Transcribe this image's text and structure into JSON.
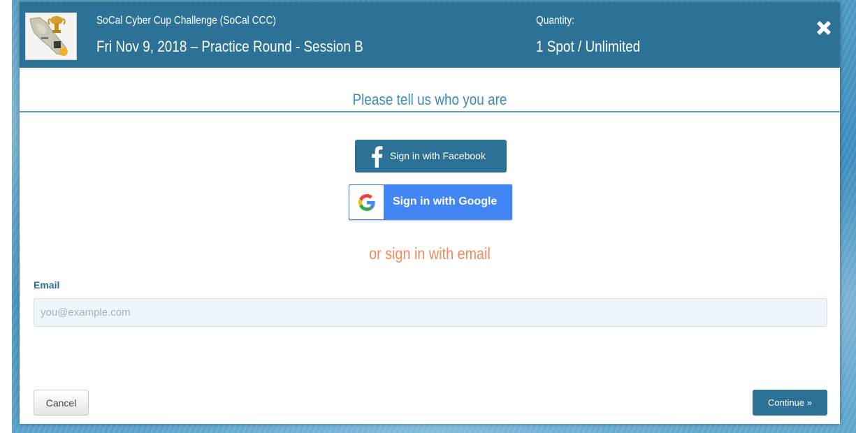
{
  "header": {
    "event_name": "SoCal Cyber Cup Challenge (SoCal CCC)",
    "event_date": "Fri Nov 9, 2018 – Practice Round - Session B",
    "quantity_label": "Quantity:",
    "quantity_value": "1 Spot / Unlimited",
    "background_color": "#2c7196",
    "logo_icon": "trophy-map-icon",
    "close_icon": "close-icon"
  },
  "form": {
    "title": "Please tell us who you are",
    "facebook_button_label": "Sign in with Facebook",
    "facebook_icon": "facebook-icon",
    "google_button_label": "Sign in with Google",
    "google_icon": "google-icon",
    "email_divider_text": "or sign in with email",
    "email_label": "Email",
    "email_placeholder": "you@example.com",
    "email_value": ""
  },
  "footer": {
    "cancel_label": "Cancel",
    "continue_label": "Continue »"
  },
  "colors": {
    "accent": "#2c7196",
    "title_blue": "#3c8ab5",
    "email_divider_orange": "#ee8a5c",
    "google_blue": "#4285f4"
  }
}
